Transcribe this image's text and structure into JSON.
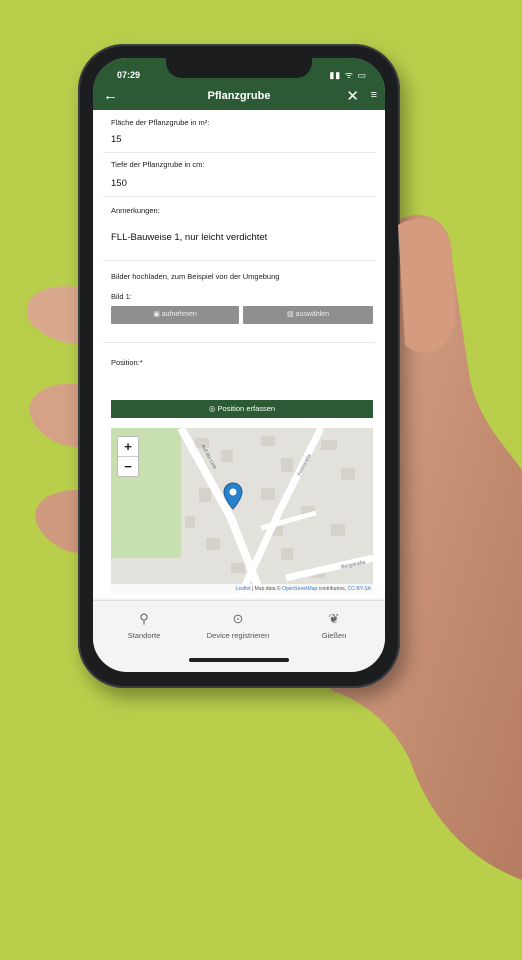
{
  "status": {
    "time": "07:29",
    "signal": "▮▮ ᯤ ▭"
  },
  "appbar": {
    "back_icon": "←",
    "title": "Pflanzgrube",
    "close_icon": "✕",
    "menu_icon": "≡"
  },
  "form": {
    "area_label": "Fläche der Pflanzgrube in m²:",
    "area_value": "15",
    "depth_label": "Tiefe der Pflanzgrube in cm:",
    "depth_value": "150",
    "notes_label": "Anmerkungen:",
    "notes_value": "FLL-Bauweise 1, nur leicht verdichtet",
    "upload_label": "Bilder hochladen, zum Beispiel von der Umgebung",
    "image_label": "Bild 1:",
    "capture_button": "aufnehmen",
    "select_button": "auswählen",
    "position_label": "Position:*",
    "position_button": "Position erfassen"
  },
  "map": {
    "zoom_in": "+",
    "zoom_out": "−",
    "street_1": "Auf der Linn",
    "street_2": "Feldsträße",
    "street_3": "Bergstraße",
    "attribution_leaflet": "Leaflet",
    "attribution_mid": " | Map data © ",
    "attribution_osm": "OpenStreetMap",
    "attribution_contrib": " contributors, ",
    "attribution_cc": "CC-BY-SA"
  },
  "tabs": [
    {
      "icon": "⚲",
      "label": "Standorte"
    },
    {
      "icon": "⊙",
      "label": "Device registrieren"
    },
    {
      "icon": "❦",
      "label": "Gießen"
    }
  ],
  "colors": {
    "background": "#b9cf4c",
    "brand_green": "#2c5a34",
    "pin_blue": "#2a81cb"
  }
}
